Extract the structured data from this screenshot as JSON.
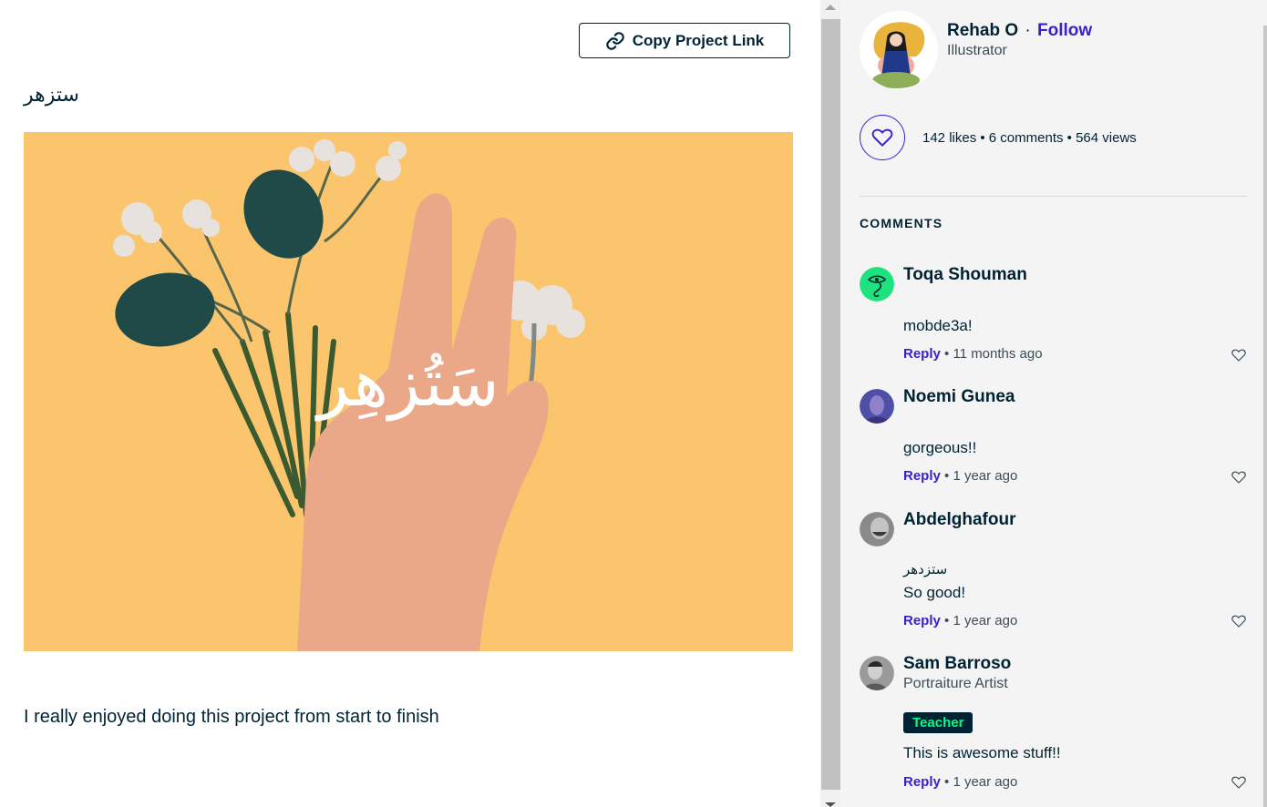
{
  "project": {
    "copy_link_label": "Copy Project Link",
    "title": "ستزهر",
    "hero_overlay_text": "سَتُزهِر",
    "description": "I really enjoyed doing this project from start to finish"
  },
  "author": {
    "name": "Rehab O",
    "separator": "·",
    "follow_label": "Follow",
    "role": "Illustrator"
  },
  "stats": {
    "text": "142 likes • 6 comments • 564 views",
    "likes": 142,
    "comments": 6,
    "views": 564
  },
  "comments_heading": "COMMENTS",
  "comments": [
    {
      "name": "Toqa Shouman",
      "body": "mobde3a!",
      "reply_label": "Reply",
      "time": "11 months ago"
    },
    {
      "name": "Noemi Gunea",
      "body": "gorgeous!!",
      "reply_label": "Reply",
      "time": "1 year ago"
    },
    {
      "name": "Abdelghafour",
      "arabic": "ستزدهر",
      "body": "So good!",
      "reply_label": "Reply",
      "time": "1 year ago"
    },
    {
      "name": "Sam Barroso",
      "subtitle": "Portraiture Artist",
      "badge": "Teacher",
      "body": "This is awesome stuff!!",
      "reply_label": "Reply",
      "time": "1 year ago"
    }
  ],
  "meta_separator": " • ",
  "colors": {
    "accent": "#3d1ecb",
    "text": "#002333",
    "badge_bg": "#002333",
    "badge_text": "#00ff84",
    "hero_bg": "#fbc56d",
    "panel_bg": "#f4f4f4"
  }
}
